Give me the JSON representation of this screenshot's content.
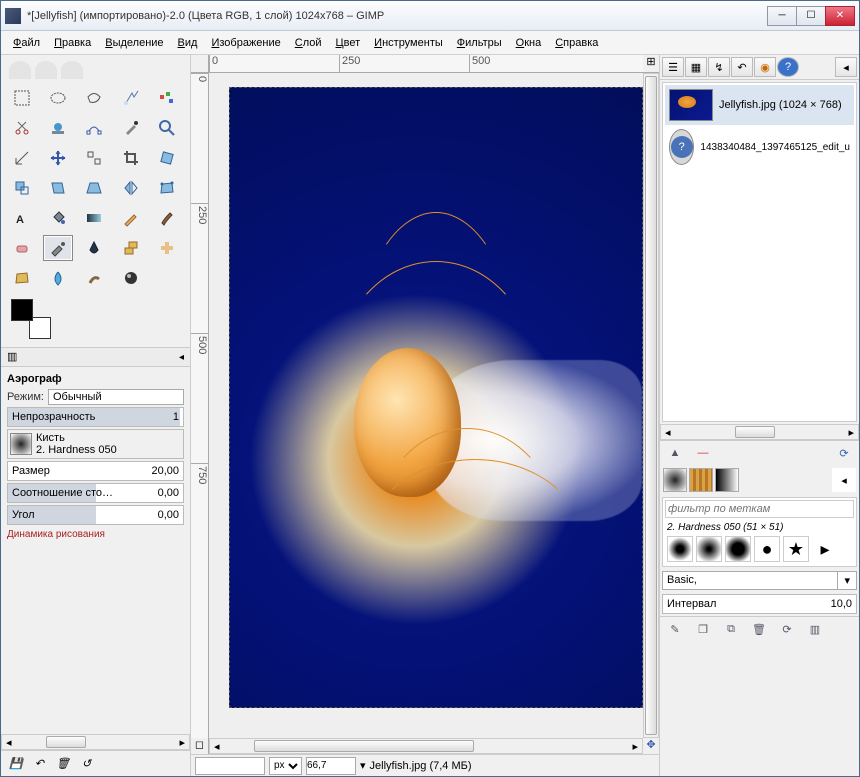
{
  "window": {
    "title": "*[Jellyfish] (импортировано)-2.0 (Цвета RGB, 1 слой) 1024x768 – GIMP"
  },
  "menu": {
    "file": "Файл",
    "edit": "Правка",
    "select": "Выделение",
    "view": "Вид",
    "image": "Изображение",
    "layer": "Слой",
    "colors": "Цвет",
    "tools": "Инструменты",
    "filters": "Фильтры",
    "windows": "Окна",
    "help": "Справка"
  },
  "toolopts": {
    "title": "Аэрограф",
    "mode_label": "Режим:",
    "mode_value": "Обычный",
    "opacity_label": "Непрозрачность",
    "opacity_value": "1",
    "brush_label": "Кисть",
    "brush_value": "2. Hardness 050",
    "size_label": "Размер",
    "size_value": "20,00",
    "aspect_label": "Соотношение сто…",
    "aspect_value": "0,00",
    "angle_label": "Угол",
    "angle_value": "0,00",
    "dynamics_label": "Динамика рисования"
  },
  "ruler": {
    "r0": "0",
    "r250": "250",
    "r500": "500",
    "v0": "0",
    "v250": "250",
    "v500": "500",
    "v750": "750"
  },
  "status": {
    "unit": "px",
    "zoom": "66,7",
    "filename": "Jellyfish.jpg (7,4 МБ)"
  },
  "images": {
    "item1": "Jellyfish.jpg (1024 × 768)",
    "item2": "1438340484_1397465125_edit_u"
  },
  "brushes": {
    "filter_placeholder": "фильтр по меткам",
    "current": "2. Hardness 050 (51 × 51)",
    "preset": "Basic,",
    "interval_label": "Интервал",
    "interval_value": "10,0"
  }
}
